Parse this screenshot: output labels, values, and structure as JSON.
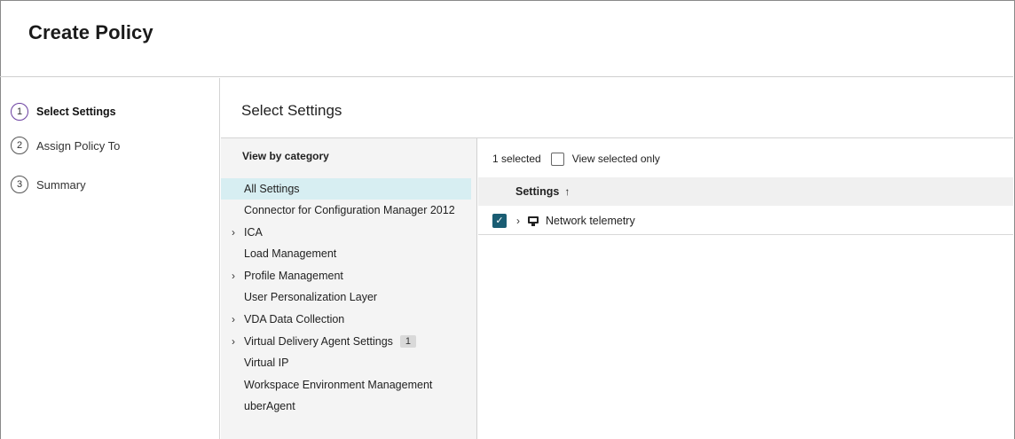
{
  "header": {
    "title": "Create Policy"
  },
  "steps": [
    {
      "number": "1",
      "label": "Select Settings",
      "active": true
    },
    {
      "number": "2",
      "label": "Assign Policy To",
      "active": false
    },
    {
      "number": "3",
      "label": "Summary",
      "active": false
    }
  ],
  "main": {
    "title": "Select Settings"
  },
  "categories": {
    "heading": "View by category",
    "items": [
      {
        "label": "All Settings",
        "expandable": false,
        "selected": true
      },
      {
        "label": "Connector for Configuration Manager 2012",
        "expandable": false
      },
      {
        "label": "ICA",
        "expandable": true
      },
      {
        "label": "Load Management",
        "expandable": false
      },
      {
        "label": "Profile Management",
        "expandable": true
      },
      {
        "label": "User Personalization Layer",
        "expandable": false
      },
      {
        "label": "VDA Data Collection",
        "expandable": true
      },
      {
        "label": "Virtual Delivery Agent Settings",
        "expandable": true,
        "badge": "1"
      },
      {
        "label": "Virtual IP",
        "expandable": false
      },
      {
        "label": "Workspace Environment Management",
        "expandable": false
      },
      {
        "label": "uberAgent",
        "expandable": false
      }
    ]
  },
  "settings": {
    "selected_count": "1 selected",
    "view_selected_only": "View selected only",
    "column_header": "Settings",
    "sort_icon": "arrow-up-icon",
    "rows": [
      {
        "label": "Network telemetry",
        "checked": true,
        "icon": "monitor-icon"
      }
    ]
  },
  "colors": {
    "accent_step": "#6a3fa0",
    "checkbox_checked": "#1a5d73",
    "selected_category": "#d7eef2"
  }
}
